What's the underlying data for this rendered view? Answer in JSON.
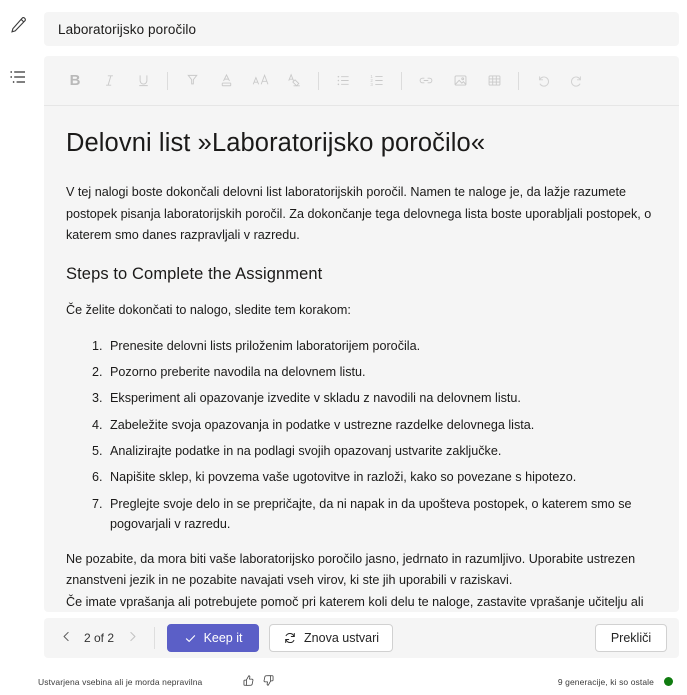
{
  "rail": {
    "items": [
      {
        "name": "edit-pencil",
        "icon": "pencil-icon",
        "tooltip": "Edit"
      },
      {
        "name": "outline-list",
        "icon": "list-outline-icon",
        "tooltip": "Outline"
      }
    ]
  },
  "title_field": {
    "value": "Laboratorijsko poročilo",
    "placeholder": "Naslov"
  },
  "toolbar": {
    "items": [
      {
        "label": "B",
        "icon": "bold-icon"
      },
      {
        "label": "I",
        "icon": "italic-icon"
      },
      {
        "label": "U",
        "icon": "underline-icon"
      },
      {
        "label": "",
        "icon": "highlight-icon"
      },
      {
        "label": "",
        "icon": "font-color-icon"
      },
      {
        "label": "",
        "icon": "font-size-icon"
      },
      {
        "label": "",
        "icon": "clear-formatting-icon"
      },
      {
        "label": "",
        "icon": "bulleted-list-icon"
      },
      {
        "label": "",
        "icon": "numbered-list-icon"
      },
      {
        "label": "",
        "icon": "link-icon"
      },
      {
        "label": "",
        "icon": "image-icon"
      },
      {
        "label": "",
        "icon": "table-icon"
      },
      {
        "label": "",
        "icon": "undo-icon"
      },
      {
        "label": "",
        "icon": "redo-icon"
      }
    ]
  },
  "document": {
    "heading": "Delovni list »Laboratorijsko poročilo«",
    "intro": "V tej nalogi boste dokončali delovni list laboratorijskih poročil. Namen te naloge je, da lažje razumete postopek pisanja laboratorijskih poročil. Za dokončanje tega delovnega lista boste uporabljali postopek, o katerem smo danes razpravljali v razredu.",
    "section_heading": "Steps to Complete the Assignment",
    "steps_lead": "Če želite dokončati to nalogo, sledite tem korakom:",
    "steps": [
      "Prenesite delovni lists priloženim laboratorijem poročila.",
      "Pozorno preberite navodila na delovnem listu.",
      "Eksperiment ali opazovanje izvedite v skladu z navodili na delovnem listu.",
      "Zabeležite svoja opazovanja in podatke v ustrezne razdelke delovnega lista.",
      "Analizirajte podatke in na podlagi svojih opazovanj ustvarite zaključke.",
      "Napišite sklep, ki povzema vaše ugotovitve in razloži, kako so povezane s hipotezo.",
      "Preglejte svoje delo in se prepričajte, da ni napak in da upošteva postopek, o katerem smo se pogovarjali v razredu."
    ],
    "closing_1": "Ne pozabite, da mora biti vaše laboratorijsko poročilo jasno, jedrnato in razumljivo. Uporabite ustrezen znanstveni jezik in ne pozabite navajati vseh virov, ki ste jih uporabili v raziskavi.",
    "closing_2": "Če imate vprašanja ali potrebujete pomoč pri katerem koli delu te naloge, zastavite vprašanje učitelju ali ta. Veliko sreče!"
  },
  "action_bar": {
    "pager_label": "2 of 2",
    "prev_icon": "chevron-left-icon",
    "next_icon": "chevron-right-icon",
    "keep_label": "Keep it",
    "keep_icon": "checkmark-icon",
    "regenerate_label": "Znova ustvari",
    "regenerate_icon": "refresh-icon",
    "cancel_label": "Prekliči"
  },
  "footer": {
    "disclaimer": "Ustvarjena vsebina ali je morda nepravilna",
    "thumbs_up_icon": "thumbs-up-icon",
    "thumbs_down_icon": "thumbs-down-icon",
    "generations_remaining": "9 generacije, ki so ostale",
    "status_color": "#107c10"
  },
  "colors": {
    "accent": "#5b5fc7",
    "panel": "#f5f5f5",
    "text": "#1b1a19",
    "status_ok": "#107c10"
  }
}
